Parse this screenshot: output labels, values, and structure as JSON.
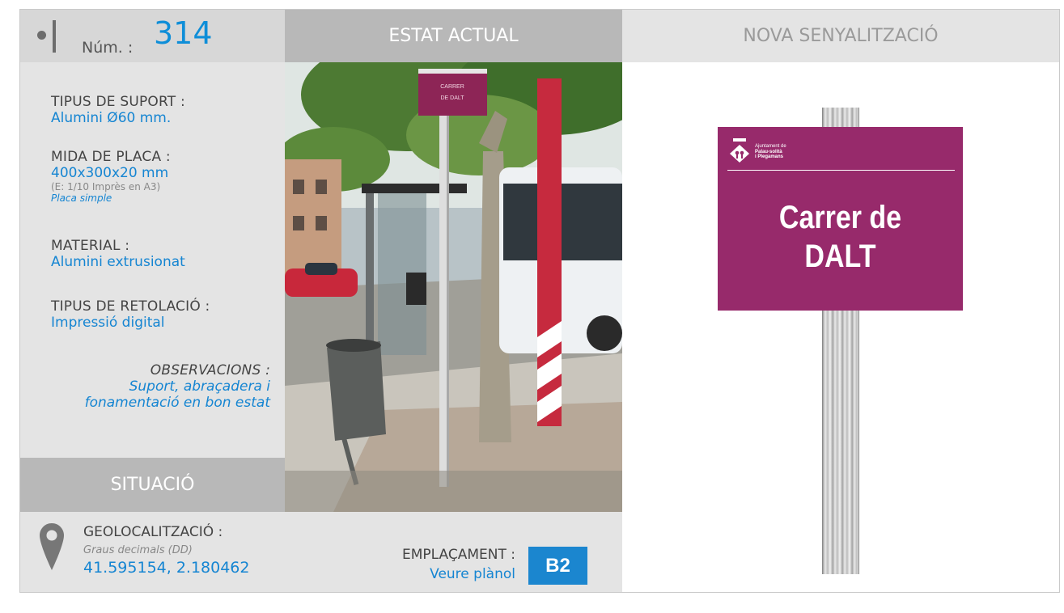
{
  "header": {
    "num_label": "Núm. :",
    "num_value": "314",
    "estat_title": "ESTAT ACTUAL",
    "nova_title": "NOVA SENYALITZACIÓ"
  },
  "specs": {
    "tipus_suport": {
      "label": "TIPUS DE SUPORT :",
      "value": "Alumini Ø60 mm."
    },
    "mida_placa": {
      "label": "MIDA DE PLACA :",
      "value": "400x300x20 mm",
      "scale_note": "(E: 1/10 Imprès en A3)",
      "type_note": "Placa simple"
    },
    "material": {
      "label": "MATERIAL :",
      "value": "Alumini extrusionat"
    },
    "retolacio": {
      "label": "TIPUS DE RETOLACIÓ :",
      "value": "Impressió digital"
    },
    "observacions": {
      "label": "OBSERVACIONS :",
      "line1": "Suport, abraçadera i",
      "line2": "fonamentació en bon estat"
    }
  },
  "situacio": {
    "title": "SITUACIÓ",
    "geo_label": "GEOLOCALITZACIÓ :",
    "geo_format": "Graus decimals (DD)",
    "geo_value": "41.595154, 2.180462",
    "empl_label": "EMPLAÇAMENT :",
    "empl_value": "Veure plànol",
    "empl_code": "B2"
  },
  "photo": {
    "sign_line1": "CARRER",
    "sign_line2": "DE DALT"
  },
  "new_sign": {
    "org_line1": "Ajuntament de",
    "org_line2": "Palau-solità",
    "org_line3": "i Plegamans",
    "line1": "Carrer de",
    "line2": "DALT"
  },
  "colors": {
    "accent_blue": "#1585d2",
    "sign_magenta": "#972a6b",
    "header_gray": "#b8b8b8"
  }
}
